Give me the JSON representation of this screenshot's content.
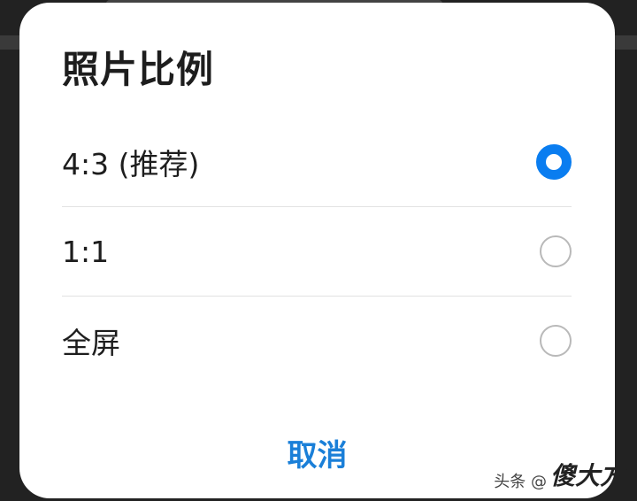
{
  "dialog": {
    "title": "照片比例",
    "options": [
      {
        "label": "4:3 (推荐)",
        "selected": true
      },
      {
        "label": "1:1",
        "selected": false
      },
      {
        "label": "全屏",
        "selected": false
      }
    ],
    "cancel_label": "取消"
  },
  "watermark": {
    "text": "头条 @",
    "logo": "傻大方"
  },
  "colors": {
    "accent": "#0a7df0",
    "cancel": "#1a7fd8",
    "radio_unchecked": "#b9b9b9",
    "divider": "#e2e2e2"
  }
}
